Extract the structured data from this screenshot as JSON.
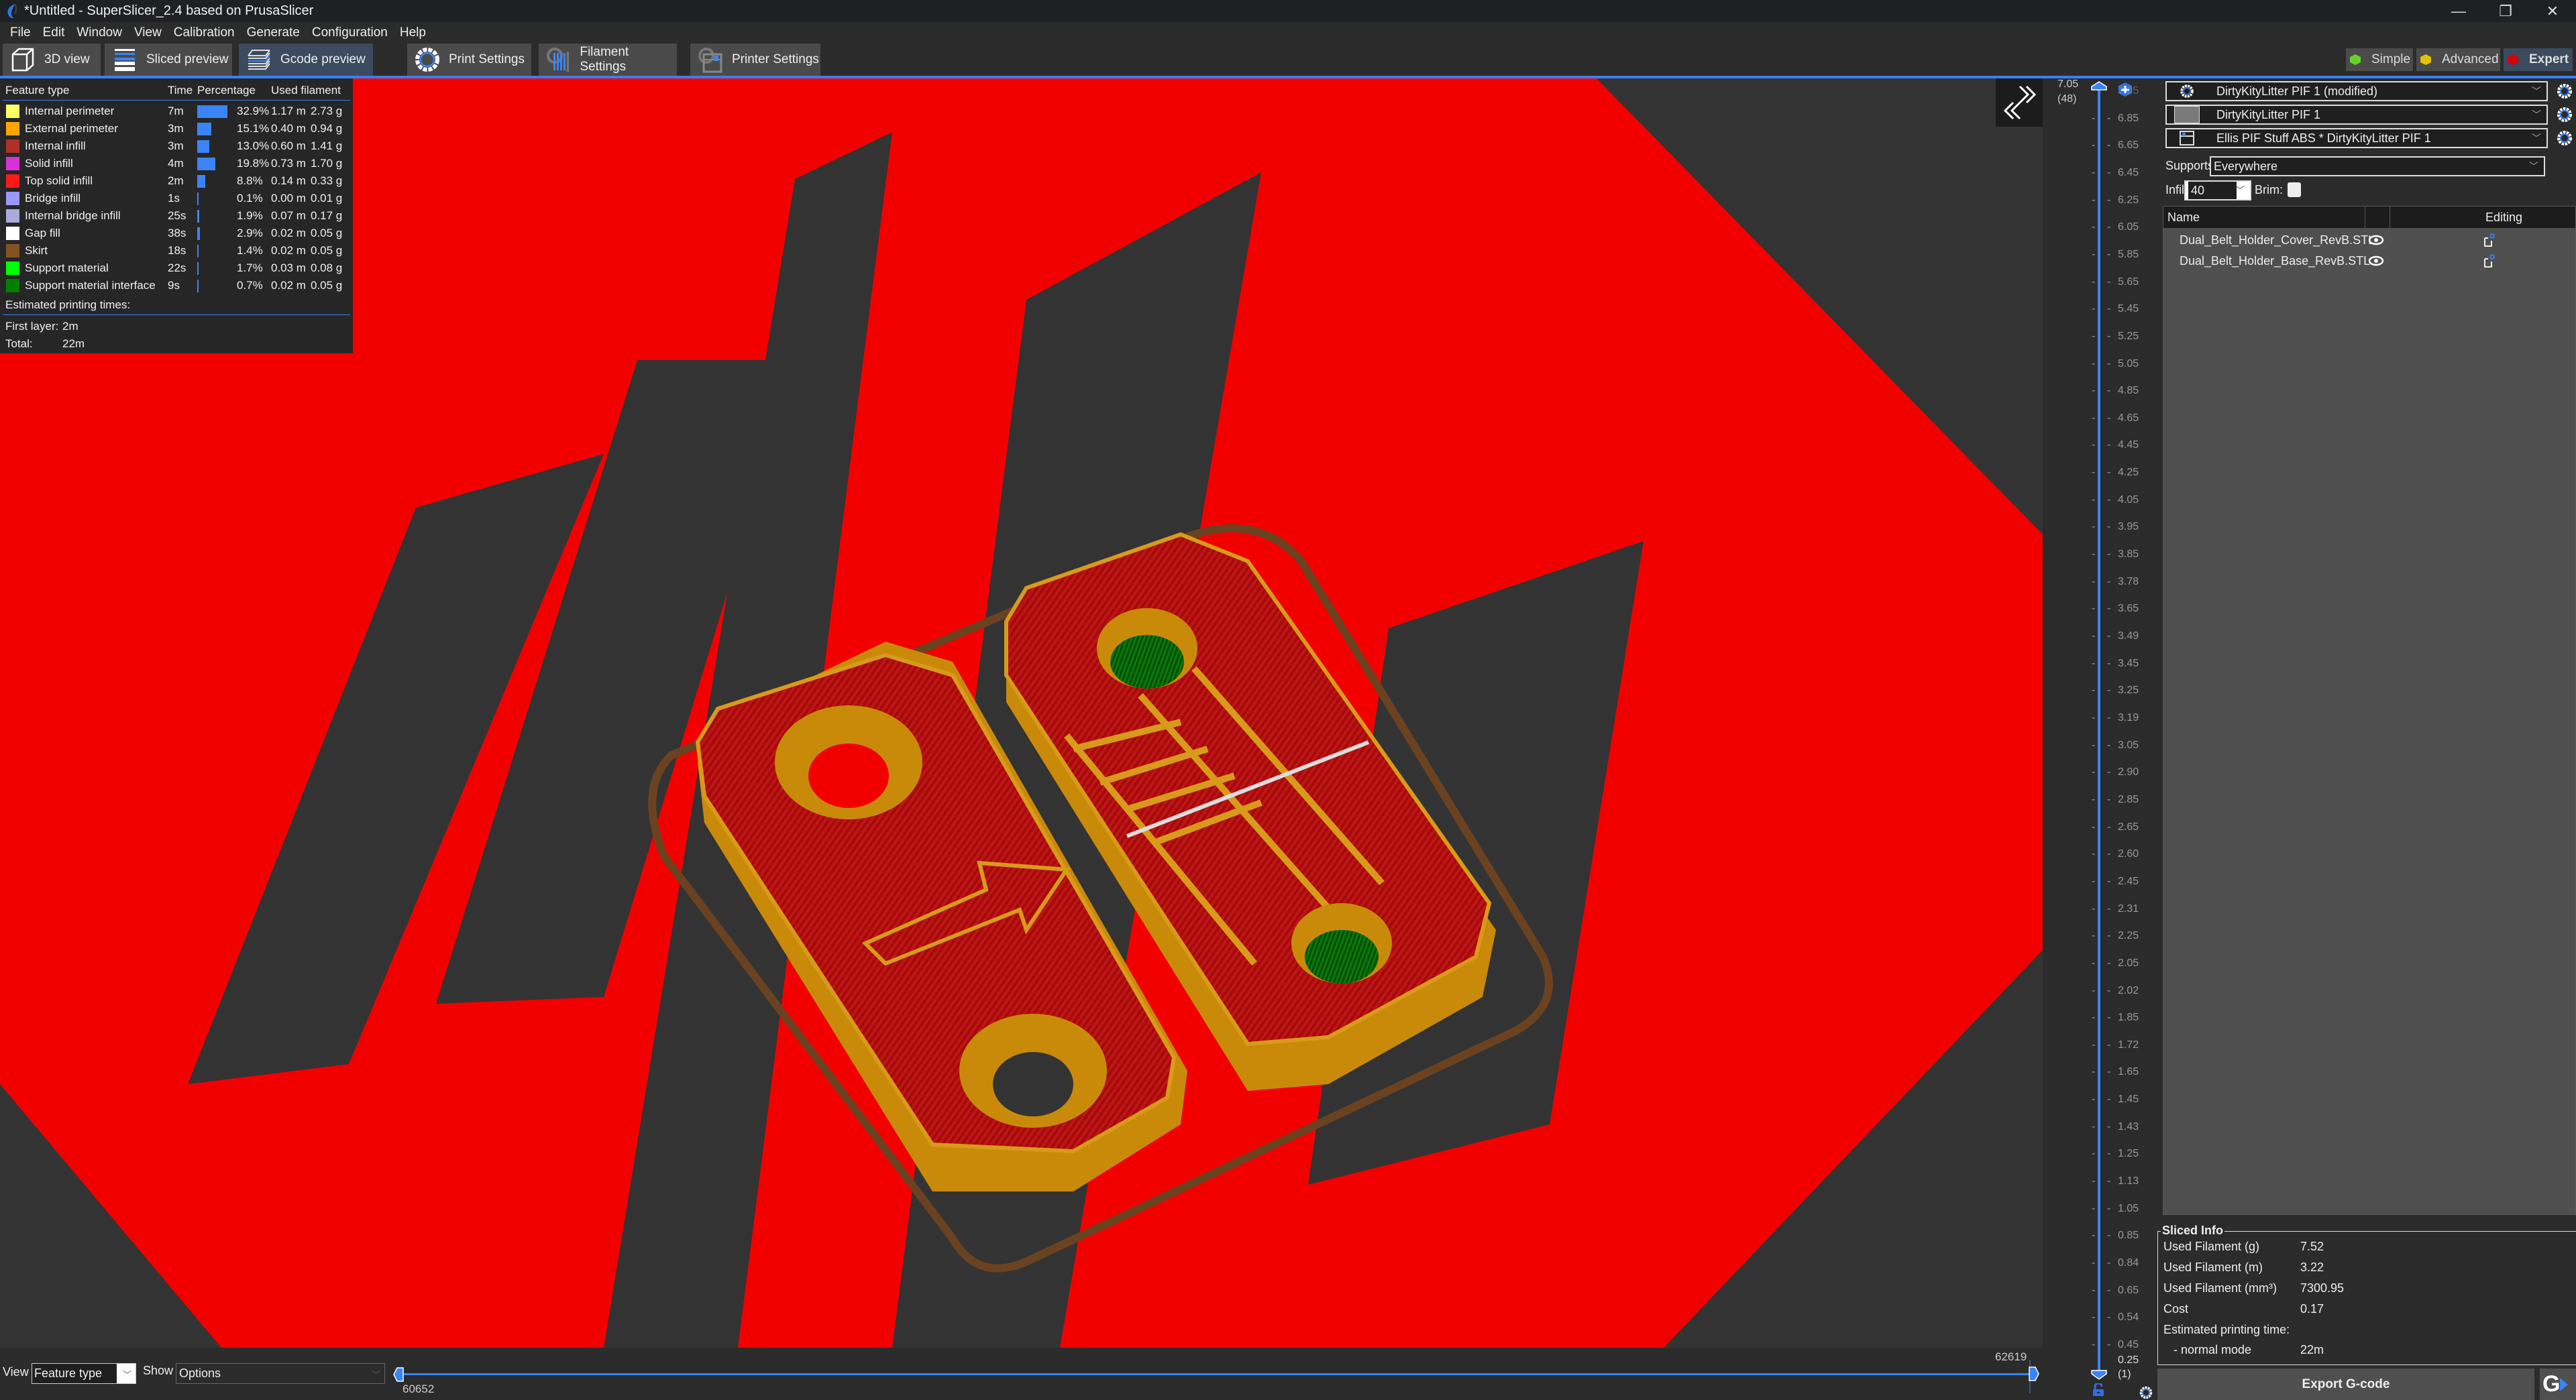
{
  "window": {
    "title": "*Untitled - SuperSlicer_2.4  based on PrusaSlicer",
    "controls": {
      "minimize": "—",
      "restore": "❐",
      "close": "✕"
    }
  },
  "menu": [
    "File",
    "Edit",
    "Window",
    "View",
    "Calibration",
    "Generate",
    "Configuration",
    "Help"
  ],
  "tabs": {
    "view3d": "3D view",
    "sliced": "Sliced preview",
    "gcode": "Gcode preview",
    "print": "Print Settings",
    "filament": "Filament Settings",
    "printer": "Printer Settings",
    "active": "Gcode preview"
  },
  "modes": {
    "simple": "Simple",
    "advanced": "Advanced",
    "expert": "Expert",
    "active": "Expert",
    "colors": {
      "simple": "#6ad12b",
      "advanced": "#e6c200",
      "expert": "#d60000"
    }
  },
  "legend": {
    "headers": {
      "feature": "Feature type",
      "time": "Time",
      "percentage": "Percentage",
      "filament": "Used filament"
    },
    "rows": [
      {
        "name": "Internal perimeter",
        "color": "#ffff66",
        "time": "7m",
        "pct": "32.9%",
        "pct_value": 32.9,
        "meters": "1.17 m",
        "grams": "2.73 g"
      },
      {
        "name": "External perimeter",
        "color": "#ffa500",
        "time": "3m",
        "pct": "15.1%",
        "pct_value": 15.1,
        "meters": "0.40 m",
        "grams": "0.94 g"
      },
      {
        "name": "Internal infill",
        "color": "#b03029",
        "time": "3m",
        "pct": "13.0%",
        "pct_value": 13.0,
        "meters": "0.60 m",
        "grams": "1.41 g"
      },
      {
        "name": "Solid infill",
        "color": "#d732d7",
        "time": "4m",
        "pct": "19.8%",
        "pct_value": 19.8,
        "meters": "0.73 m",
        "grams": "1.70 g"
      },
      {
        "name": "Top solid infill",
        "color": "#ff1a1a",
        "time": "2m",
        "pct": "8.8%",
        "pct_value": 8.8,
        "meters": "0.14 m",
        "grams": "0.33 g"
      },
      {
        "name": "Bridge infill",
        "color": "#9999ff",
        "time": "1s",
        "pct": "0.1%",
        "pct_value": 0.1,
        "meters": "0.00 m",
        "grams": "0.01 g"
      },
      {
        "name": "Internal bridge infill",
        "color": "#aaaadd",
        "time": "25s",
        "pct": "1.9%",
        "pct_value": 1.9,
        "meters": "0.07 m",
        "grams": "0.17 g"
      },
      {
        "name": "Gap fill",
        "color": "#ffffff",
        "time": "38s",
        "pct": "2.9%",
        "pct_value": 2.9,
        "meters": "0.02 m",
        "grams": "0.05 g"
      },
      {
        "name": "Skirt",
        "color": "#845321",
        "time": "18s",
        "pct": "1.4%",
        "pct_value": 1.4,
        "meters": "0.02 m",
        "grams": "0.05 g"
      },
      {
        "name": "Support material",
        "color": "#00ff00",
        "time": "22s",
        "pct": "1.7%",
        "pct_value": 1.7,
        "meters": "0.03 m",
        "grams": "0.08 g"
      },
      {
        "name": "Support material interface",
        "color": "#008000",
        "time": "9s",
        "pct": "0.7%",
        "pct_value": 0.7,
        "meters": "0.02 m",
        "grams": "0.05 g"
      }
    ],
    "estimated_label": "Estimated printing times:",
    "first_layer_label": "First layer:",
    "first_layer_value": "2m",
    "total_label": "Total:",
    "total_value": "22m"
  },
  "layer_slider": {
    "top_value": "7.05",
    "top_layer": "(48)",
    "bottom_value": "0.25",
    "bottom_layer": "(1)",
    "ticks": [
      "7.05",
      "6.85",
      "6.65",
      "6.45",
      "6.25",
      "6.05",
      "5.85",
      "5.65",
      "5.45",
      "5.25",
      "5.05",
      "4.85",
      "4.65",
      "4.45",
      "4.25",
      "4.05",
      "3.95",
      "3.85",
      "3.78",
      "3.65",
      "3.49",
      "3.45",
      "3.25",
      "3.19",
      "3.05",
      "2.90",
      "2.85",
      "2.65",
      "2.60",
      "2.45",
      "2.31",
      "2.25",
      "2.05",
      "2.02",
      "1.85",
      "1.72",
      "1.65",
      "1.45",
      "1.43",
      "1.25",
      "1.13",
      "1.05",
      "0.85",
      "0.84",
      "0.65",
      "0.54",
      "0.45"
    ]
  },
  "move_slider": {
    "start": "60652",
    "end": "62619"
  },
  "bottom_controls": {
    "view_label": "View",
    "view_value": "Feature type",
    "show_label": "Show",
    "show_value": "Options"
  },
  "presets": {
    "print": "DirtyKityLitter PIF 1 (modified)",
    "filament": "DirtyKityLitter PIF 1",
    "filament_color": "#7a7a7a",
    "printer": "Ellis PIF Stuff ABS * DirtyKityLitter PIF 1",
    "supports_label": "Supports:",
    "supports_value": "Everywhere",
    "infill_label": "Infill:",
    "infill_value": "40",
    "brim_label": "Brim:",
    "brim_checked": false
  },
  "object_list": {
    "col_name": "Name",
    "col_editing": "Editing",
    "objects": [
      {
        "name": "Dual_Belt_Holder_Cover_RevB.STL"
      },
      {
        "name": "Dual_Belt_Holder_Base_RevB.STL"
      }
    ]
  },
  "sliced_info": {
    "title": "Sliced Info",
    "rows": [
      {
        "label": "Used Filament (g)",
        "value": "7.52"
      },
      {
        "label": "Used Filament (m)",
        "value": "3.22"
      },
      {
        "label": "Used Filament (mm³)",
        "value": "7300.95"
      },
      {
        "label": "Cost",
        "value": "0.17"
      },
      {
        "label": "Estimated printing time:",
        "value": ""
      },
      {
        "label": "   - normal mode",
        "value": "22m"
      }
    ]
  },
  "export": {
    "label": "Export G-code",
    "send_glyph": "G"
  },
  "accent": "#3a84f5"
}
